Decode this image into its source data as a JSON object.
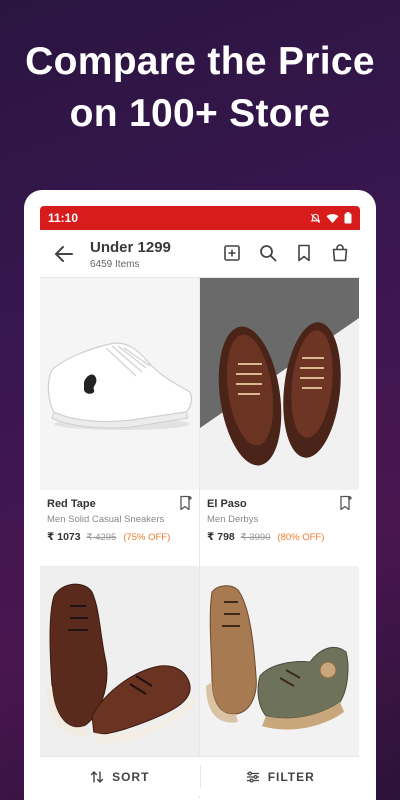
{
  "promo": {
    "line1": "Compare the Price",
    "line2": "on 100+ Store"
  },
  "status_bar": {
    "time": "11:10",
    "color": "#d81c1c"
  },
  "header": {
    "title": "Under 1299",
    "subtitle": "6459 Items",
    "icons": [
      "back-arrow-icon",
      "add-box-icon",
      "search-icon",
      "bookmark-icon",
      "bag-icon"
    ]
  },
  "products": [
    {
      "brand": "Red Tape",
      "description": "Men Solid Casual Sneakers",
      "price": "₹ 1073",
      "mrp": "₹ 4295",
      "discount": "(75% OFF)"
    },
    {
      "brand": "El Paso",
      "description": "Men Derbys",
      "price": "₹ 798",
      "mrp": "₹ 3990",
      "discount": "(80% OFF)"
    },
    {
      "brand": "",
      "description": "",
      "price": "",
      "mrp": "",
      "discount": ""
    },
    {
      "brand": "",
      "description": "",
      "price": "",
      "mrp": "",
      "discount": ""
    }
  ],
  "bottom_bar": {
    "sort_label": "SORT",
    "filter_label": "FILTER"
  },
  "colors": {
    "accent": "#d81c1c",
    "discount": "#f07a2a",
    "background_gradient": [
      "#2a1540",
      "#4a1650"
    ]
  }
}
